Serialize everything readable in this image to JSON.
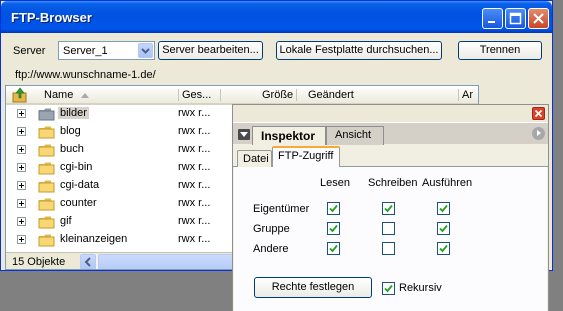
{
  "window": {
    "title": "FTP-Browser",
    "controls": [
      "minimize-icon",
      "maximize-icon",
      "close-icon"
    ]
  },
  "server_bar": {
    "label": "Server",
    "selected": "Server_1",
    "edit_button": "Server bearbeiten...",
    "local_button": "Lokale Festplatte durchsuchen...",
    "disconnect_button": "Trennen"
  },
  "url": "ftp://www.wunschname-1.de/",
  "list": {
    "columns": [
      "Name",
      "Ges...",
      "Größe",
      "Geändert",
      "Ar"
    ],
    "rows": [
      {
        "name": "bilder",
        "perm": "rwx r...",
        "selected": true
      },
      {
        "name": "blog",
        "perm": "rwx r..."
      },
      {
        "name": "buch",
        "perm": "rwx r..."
      },
      {
        "name": "cgi-bin",
        "perm": "rwx r..."
      },
      {
        "name": "cgi-data",
        "perm": "rwx r..."
      },
      {
        "name": "counter",
        "perm": "rwx r..."
      },
      {
        "name": "gif",
        "perm": "rwx r..."
      },
      {
        "name": "kleinanzeigen",
        "perm": "rwx r..."
      }
    ],
    "status": "15 Objekte"
  },
  "inspector": {
    "tabs": [
      "Inspektor",
      "Ansicht"
    ],
    "subtabs": [
      "Datei",
      "FTP-Zugriff"
    ],
    "columns": [
      "Lesen",
      "Schreiben",
      "Ausführen"
    ],
    "rows": [
      {
        "label": "Eigentümer",
        "checks": [
          true,
          true,
          true
        ]
      },
      {
        "label": "Gruppe",
        "checks": [
          true,
          false,
          true
        ]
      },
      {
        "label": "Andere",
        "checks": [
          true,
          false,
          true
        ]
      }
    ],
    "apply_button": "Rechte festlegen",
    "recursive_label": "Rekursiv",
    "recursive_checked": true
  }
}
